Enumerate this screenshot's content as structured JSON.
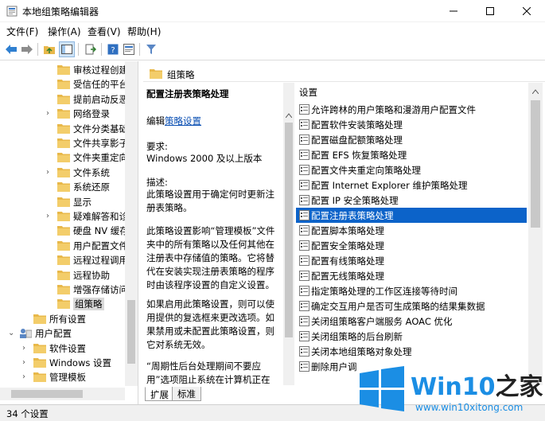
{
  "window": {
    "title": "本地组策略编辑器"
  },
  "menu": [
    "文件(F)",
    "操作(A)",
    "查看(V)",
    "帮助(H)"
  ],
  "tree": [
    {
      "label": "审核过程创建",
      "depth": 2,
      "expander": ""
    },
    {
      "label": "受信任的平台",
      "depth": 2,
      "expander": ""
    },
    {
      "label": "提前启动反恶意软件",
      "depth": 2,
      "expander": ""
    },
    {
      "label": "网络登录",
      "depth": 2,
      "expander": ">"
    },
    {
      "label": "文件分类基础结构",
      "depth": 2,
      "expander": ""
    },
    {
      "label": "文件共享影子副本提供程序",
      "depth": 2,
      "expander": ""
    },
    {
      "label": "文件夹重定向",
      "depth": 2,
      "expander": ""
    },
    {
      "label": "文件系统",
      "depth": 2,
      "expander": ">"
    },
    {
      "label": "系统还原",
      "depth": 2,
      "expander": ""
    },
    {
      "label": "显示",
      "depth": 2,
      "expander": ""
    },
    {
      "label": "疑难解答和诊断",
      "depth": 2,
      "expander": ">"
    },
    {
      "label": "硬盘 NV 缓存",
      "depth": 2,
      "expander": ""
    },
    {
      "label": "用户配置文件",
      "depth": 2,
      "expander": ""
    },
    {
      "label": "远程过程调用",
      "depth": 2,
      "expander": ""
    },
    {
      "label": "远程协助",
      "depth": 2,
      "expander": ""
    },
    {
      "label": "增强存储访问",
      "depth": 2,
      "expander": ""
    },
    {
      "label": "组策略",
      "depth": 2,
      "expander": "",
      "selected": true
    },
    {
      "label": "所有设置",
      "depth": 1,
      "expander": ""
    },
    {
      "label": "用户配置",
      "depth": 0,
      "expander": "v",
      "icon": "user"
    },
    {
      "label": "软件设置",
      "depth": 1,
      "expander": ">"
    },
    {
      "label": "Windows 设置",
      "depth": 1,
      "expander": ">"
    },
    {
      "label": "管理模板",
      "depth": 1,
      "expander": ">"
    }
  ],
  "middle": {
    "header": "组策略",
    "policy_title": "配置注册表策略处理",
    "edit_prefix": "编辑",
    "edit_link": "策略设置",
    "requirements_label": "要求:",
    "requirements": "Windows 2000 及以上版本",
    "desc_label": "描述:",
    "desc1": "此策略设置用于确定何时更新注册表策略。",
    "desc2": "此策略设置影响“管理模板”文件夹中的所有策略以及任何其他在注册表中存储值的策略。它将替代在安装实现注册表策略的程序时由该程序设置的自定义设置。",
    "desc3": "如果启用此策略设置，则可以使用提供的复选框来更改选项。如果禁用或未配置此策略设置，则它对系统无效。",
    "desc4": "“周期性后台处理期间不要应用”选项阻止系统在计算机正在使用时后"
  },
  "right": {
    "column_header": "设置",
    "items": [
      {
        "label": "允许跨林的用户策略和漫游用户配置文件"
      },
      {
        "label": "配置软件安装策略处理"
      },
      {
        "label": "配置磁盘配额策略处理"
      },
      {
        "label": "配置 EFS 恢复策略处理"
      },
      {
        "label": "配置文件夹重定向策略处理"
      },
      {
        "label": "配置 Internet Explorer 维护策略处理"
      },
      {
        "label": "配置 IP 安全策略处理"
      },
      {
        "label": "配置注册表策略处理",
        "selected": true
      },
      {
        "label": "配置脚本策略处理"
      },
      {
        "label": "配置安全策略处理"
      },
      {
        "label": "配置有线策略处理"
      },
      {
        "label": "配置无线策略处理"
      },
      {
        "label": "指定策略处理的工作区连接等待时间"
      },
      {
        "label": "确定交互用户是否可生成策略的结果集数据"
      },
      {
        "label": "关闭组策略客户端服务 AOAC 优化"
      },
      {
        "label": "关闭组策略的后台刷新"
      },
      {
        "label": "关闭本地组策略对象处理"
      },
      {
        "label": "删除用户调"
      }
    ]
  },
  "tabs": [
    "扩展",
    "标准"
  ],
  "status": "34 个设置",
  "watermark": {
    "brand": "Win10",
    "suffix": "之家",
    "url": "www.win10xitong.com"
  },
  "colors": {
    "selection": "#0c63c9",
    "link": "#0a4fb3",
    "folder": "#e8b84a",
    "brand_blue": "#1b8ee4"
  }
}
